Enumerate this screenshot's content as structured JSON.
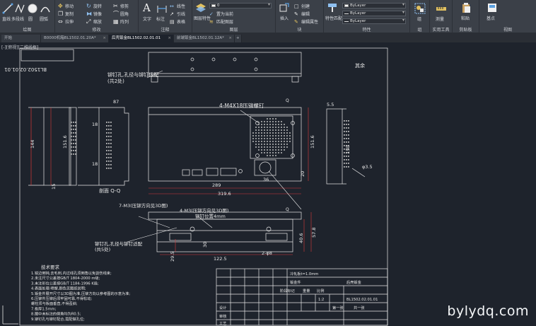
{
  "ribbon": {
    "draw_panel": {
      "title": "绘图",
      "line": "直线",
      "polyline": "多段线",
      "circle": "圆",
      "arc": "圆弧"
    },
    "modify_panel": {
      "title": "修改",
      "move": "移动",
      "rotate": "旋转",
      "trim": "修剪",
      "copy": "复制",
      "mirror": "镜像",
      "fillet": "圆角",
      "stretch": "拉伸",
      "scale": "缩放",
      "array": "阵列"
    },
    "annotation_panel": {
      "title": "注释",
      "text": "文字",
      "dimension": "标注",
      "linear": "线性",
      "leader": "引线",
      "table": "表格"
    },
    "layers_panel": {
      "title": "图层",
      "layer_props": "图层特性",
      "current_layer": "0",
      "make_current": "置为当前",
      "match_layer": "匹配图层"
    },
    "block_panel": {
      "title": "块",
      "insert": "插入",
      "create": "创建",
      "edit": "编辑",
      "edit_attr": "编辑属性"
    },
    "properties_panel": {
      "title": "特性",
      "match_props": "特性匹配",
      "color": "ByLayer",
      "linetype": "ByLayer",
      "lineweight": "ByLayer"
    },
    "groups_panel": {
      "title": "组",
      "group": "组"
    },
    "utilities_panel": {
      "title": "实用工具",
      "measure": "测量"
    },
    "clipboard_panel": {
      "title": "剪贴板",
      "paste": "粘贴"
    },
    "view_panel": {
      "title": "视图",
      "base": "基点"
    }
  },
  "tabs": [
    {
      "label": "开始",
      "active": false
    },
    {
      "label": "B0000机箱BL1502.01.20A*",
      "active": false
    },
    {
      "label": "后壳钣金BL1502.02.01.01",
      "active": true
    },
    {
      "label": "前端钣金BL1502.01.12A*",
      "active": false
    }
  ],
  "viewport_label": "[-][俯视][二维线框]",
  "drawing": {
    "drawing_number_rotated": "BL1502.02.01.01",
    "rivet_note_top": "铆钉孔,孔径与铆钉适配",
    "rivet_count_top": "(共2处)",
    "rivet_note_bottom": "铆钉孔,孔径与铆钉适配",
    "rivet_count_bottom": "(共5处)",
    "press_rivet": "4-M4X18压铆螺钉",
    "section_label": "剖面 Q-Q",
    "section_mark": "Q",
    "roughness": "其余",
    "dims": {
      "d144": "144",
      "d151_6a": "151.6",
      "d18a": "18",
      "d18b": "18",
      "d15": "15",
      "d87": "87",
      "d289": "289",
      "d319_6": "319.6",
      "d36": "36",
      "d20": "20",
      "d151_6b": "151.6",
      "d150": "150",
      "d5_5": "5.5",
      "d3_5": "φ3.5",
      "d122_5": "122.5",
      "d29_5": "29.5",
      "d40_6": "40.6",
      "d57_8": "57.8",
      "d2phi8": "2-φ8",
      "d30": "30"
    },
    "m_note_top": "7-M3(压铆方向见3D图)",
    "m_note_mid": "4-M3(压铆方向见3D图)",
    "rivet_pos": "铆钉位置4mm",
    "tech_title": "技术要求",
    "tech_lines": [
      "1.锐边倒钝,去毛刺,内过线孔须倒角以免割伤线束;",
      "2.未注尺寸公差按GB/T 1804-2000 m级;",
      "3.未注形位公差按GB/T 1184-1996 K级;",
      "4.表面处理:喷塑,颜色见图纸说明;",
      "5.钣金件展开尺寸以3D图为准,压铆方向以参考图的示意为准;",
      "6.压铆件压铆后须牢固可靠,不得松动;",
      "  螺柱须与板面垂直,不得歪斜;",
      "7.板厚1.5mm;",
      "8.图中未标注的倒角均为R0.5;",
      "9.铆钉孔与铆钉配合,需配做孔位;"
    ],
    "title_block": {
      "material": "冷轧板t=1.0mm",
      "part_name": "后壳钣金",
      "part_type": "钣金件",
      "code": "BL1502.02.01.01",
      "weight_label": "重量",
      "scale_label": "比例",
      "scale": "1:2",
      "stage": "阶段标记",
      "sheet": "第一张",
      "total": "共一张",
      "designer": "设计",
      "checker": "审核",
      "process": "工艺"
    }
  },
  "watermark": "bylydq.com",
  "colors": {
    "ribbon_bg": "#3b4048",
    "canvas_bg": "#1e232c",
    "drawing_line": "#e8e8e8",
    "dim_red": "#d83a3a"
  }
}
